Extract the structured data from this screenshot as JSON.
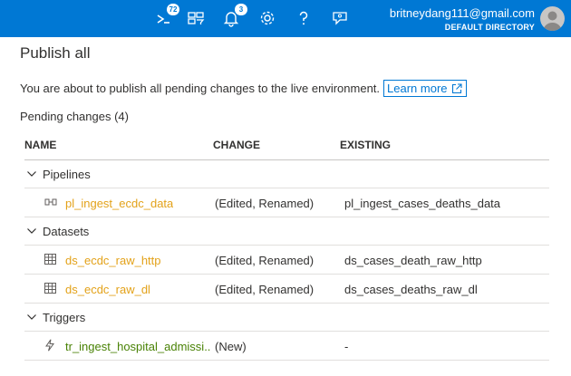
{
  "topbar": {
    "cloud_shell_badge": "72",
    "notifications_badge": "3",
    "icons": [
      "cloud-shell-icon",
      "directory-filter-icon",
      "bell-icon",
      "gear-icon",
      "help-icon",
      "feedback-icon"
    ],
    "account": {
      "email": "britneydang111@gmail.com",
      "directory": "DEFAULT DIRECTORY"
    }
  },
  "panel": {
    "title": "Publish all",
    "description": "You are about to publish all pending changes to the live environment.",
    "learn_more": "Learn more",
    "pending_heading": "Pending changes (4)"
  },
  "table": {
    "columns": [
      "NAME",
      "CHANGE",
      "EXISTING"
    ],
    "groups": [
      {
        "label": "Pipelines",
        "items": [
          {
            "name": "pl_ingest_ecdc_data",
            "change": "(Edited, Renamed)",
            "existing": "pl_ingest_cases_deaths_data",
            "icon": "pipeline-icon"
          }
        ]
      },
      {
        "label": "Datasets",
        "items": [
          {
            "name": "ds_ecdc_raw_http",
            "change": "(Edited, Renamed)",
            "existing": "ds_cases_death_raw_http",
            "icon": "table-icon"
          },
          {
            "name": "ds_ecdc_raw_dl",
            "change": "(Edited, Renamed)",
            "existing": "ds_cases_deaths_raw_dl",
            "icon": "table-icon"
          }
        ]
      },
      {
        "label": "Triggers",
        "items": [
          {
            "name": "tr_ingest_hospital_admissi...",
            "change": "(New)",
            "existing": "-",
            "icon": "trigger-icon"
          }
        ]
      }
    ]
  },
  "colors": {
    "topbar": "#0078d4",
    "link": "#0078d4",
    "item_name": "#e3a21a",
    "trigger_name": "#498205"
  }
}
